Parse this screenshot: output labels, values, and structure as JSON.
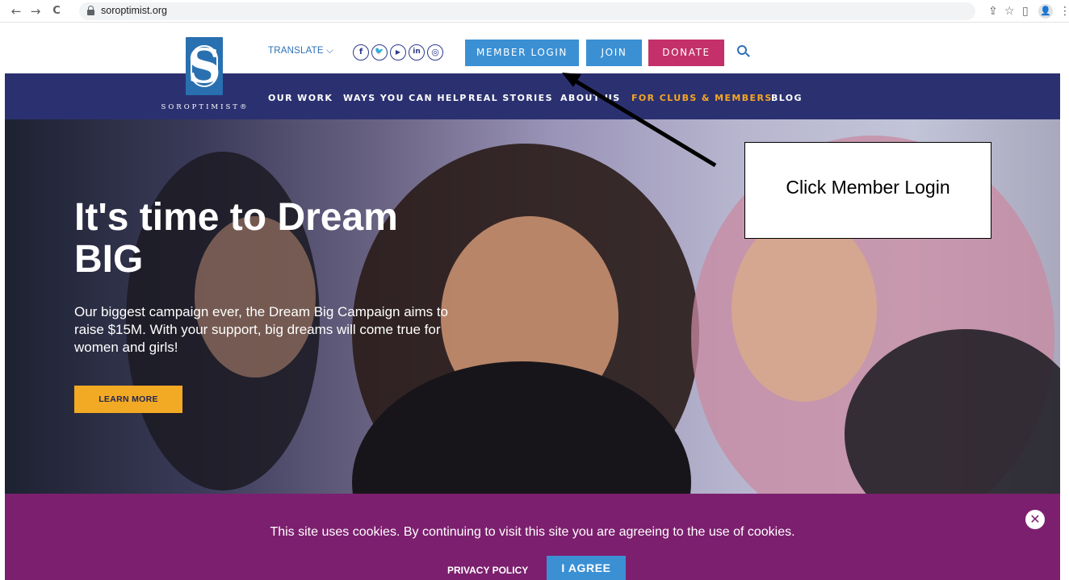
{
  "browser": {
    "url": "soroptimist.org",
    "back_glyph": "←",
    "forward_glyph": "→",
    "reload_glyph": "C",
    "share_glyph": "⇪",
    "star_glyph": "☆",
    "sidebar_glyph": "▯",
    "profile_glyph": "👤",
    "menu_glyph": "⋮"
  },
  "site": {
    "logo_letter": "S",
    "logo_word": "SOROPTIMIST®",
    "translate_label": "TRANSLATE ⌵",
    "social": [
      {
        "name": "facebook-icon",
        "glyph": "f"
      },
      {
        "name": "twitter-icon",
        "glyph": "🐦"
      },
      {
        "name": "youtube-icon",
        "glyph": "▶"
      },
      {
        "name": "linkedin-icon",
        "glyph": "in"
      },
      {
        "name": "instagram-icon",
        "glyph": "◎"
      }
    ],
    "member_login": "MEMBER LOGIN",
    "join": "JOIN",
    "donate": "DONATE",
    "nav": [
      {
        "label": "OUR WORK"
      },
      {
        "label": "WAYS YOU CAN HELP"
      },
      {
        "label": "REAL STORIES"
      },
      {
        "label": "ABOUT US"
      },
      {
        "label": "FOR CLUBS & MEMBERS"
      },
      {
        "label": "BLOG"
      }
    ],
    "colors": {
      "navy": "#2b3170",
      "blue": "#3b90d4",
      "donate": "#c4306a",
      "accent": "#f6a623",
      "cookie_bg": "#7c1f6e"
    }
  },
  "hero": {
    "title": "It's time to Dream BIG",
    "text": "Our biggest campaign ever, the Dream Big Campaign aims to raise $15M. With your support, big dreams will come true for women and girls!",
    "cta": "LEARN MORE"
  },
  "annotation": {
    "text": "Click Member Login"
  },
  "cookie": {
    "message": "This site uses cookies. By continuing to visit this site you are agreeing to the use of cookies.",
    "privacy": "PRIVACY POLICY",
    "agree": "I AGREE",
    "close_glyph": "✕"
  }
}
